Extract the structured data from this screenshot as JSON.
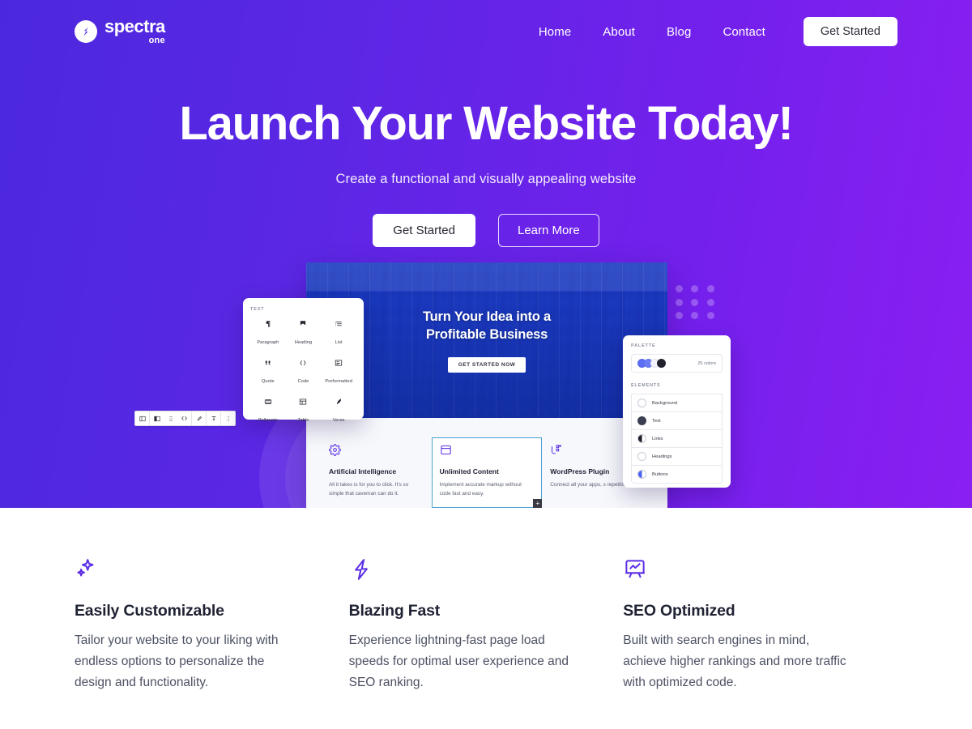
{
  "brand": {
    "name": "spectra",
    "suffix": "one",
    "logo_icon": "spectra-s-logo-icon",
    "accent": "#5b2ee5",
    "hero_gradient_from": "#4b28de",
    "hero_gradient_to": "#8a1ff2"
  },
  "nav": {
    "links": [
      {
        "label": "Home"
      },
      {
        "label": "About"
      },
      {
        "label": "Blog"
      },
      {
        "label": "Contact"
      }
    ],
    "cta_label": "Get Started"
  },
  "hero": {
    "title": "Launch Your Website Today!",
    "subtitle": "Create a functional and visually appealing website",
    "primary_cta": "Get Started",
    "secondary_cta": "Learn More"
  },
  "mockup": {
    "hero_line1": "Turn Your Idea into a",
    "hero_line2": "Profitable Business",
    "hero_button": "GET STARTED NOW",
    "features": [
      {
        "icon": "gear-icon",
        "title": "Artificial Intelligence",
        "desc": "All it takes is for you to click. It's so simple that caveman can do it."
      },
      {
        "icon": "window-icon",
        "title": "Unlimited Content",
        "desc": "Implement accurate markup without code fast and easy."
      },
      {
        "icon": "plugin-icon",
        "title": "WordPress Plugin",
        "desc": "Connect all your apps, s repetitive tasks."
      }
    ],
    "toolbar_icons": [
      "block-type-icon",
      "transform-icon",
      "drag-handle-icon",
      "move-icon",
      "link-icon",
      "align-icon",
      "more-options-icon"
    ],
    "add_block_label": "+"
  },
  "text_panel": {
    "label": "TEXT",
    "blocks": [
      {
        "name": "Paragraph",
        "icon": "paragraph-icon"
      },
      {
        "name": "Heading",
        "icon": "heading-icon"
      },
      {
        "name": "List",
        "icon": "list-icon"
      },
      {
        "name": "Quote",
        "icon": "quote-icon"
      },
      {
        "name": "Code",
        "icon": "code-icon"
      },
      {
        "name": "Preformatted",
        "icon": "preformatted-icon"
      },
      {
        "name": "Pullquote",
        "icon": "pullquote-icon"
      },
      {
        "name": "Table",
        "icon": "table-icon"
      },
      {
        "name": "Verse",
        "icon": "verse-icon"
      }
    ]
  },
  "palette_panel": {
    "label": "PALETTE",
    "colors_count": "25 colors",
    "swatches": [
      "#5b6ef5",
      "#6c7cf7",
      "#f2f3fb",
      "#23232e"
    ],
    "elements_label": "ELEMENTS",
    "elements": [
      {
        "name": "Background",
        "swatch": "#ffffff",
        "style": "outline"
      },
      {
        "name": "Text",
        "swatch": "#3a3f51",
        "style": "solid"
      },
      {
        "name": "Links",
        "swatch": "#1d1d28",
        "style": "half"
      },
      {
        "name": "Headings",
        "swatch": "#ffffff",
        "style": "empty"
      },
      {
        "name": "Buttons",
        "swatch": "#4d62f0",
        "style": "half"
      }
    ]
  },
  "features": [
    {
      "icon": "sparkles-icon",
      "title": "Easily Customizable",
      "desc": "Tailor your website to your liking with endless options to personalize the design and functionality."
    },
    {
      "icon": "lightning-bolt-icon",
      "title": "Blazing Fast",
      "desc": "Experience lightning-fast page load speeds for optimal user experience and SEO ranking."
    },
    {
      "icon": "seo-chart-board-icon",
      "title": "SEO Optimized",
      "desc": "Built with search engines in mind, achieve higher rankings and more traffic with optimized code."
    }
  ]
}
